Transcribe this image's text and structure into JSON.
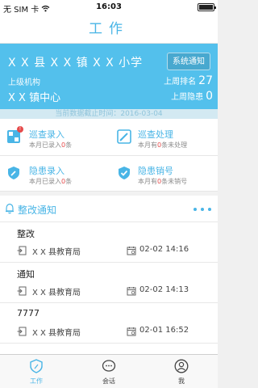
{
  "status_bar": {
    "carrier": "无 SIM 卡",
    "time": "16:03"
  },
  "title_bar": {
    "title": "工作"
  },
  "school": {
    "name": "X X 县 X X 镇 X X 小学",
    "notice_button": "系统通知",
    "parent_label": "上级机构",
    "parent_name": "X X 镇中心",
    "rank_label": "上周排名",
    "rank_value": "27",
    "hazard_label": "上周隐患",
    "hazard_value": "0"
  },
  "data_date": "当前数据截止时间：2016-03-04",
  "actions": [
    {
      "name": "巡查录入",
      "sub_pre": "本月已录入",
      "sub_num": "0",
      "sub_post": "条",
      "icon": "patrol-entry-icon",
      "badge": "!"
    },
    {
      "name": "巡查处理",
      "sub_pre": "本月有",
      "sub_num": "0",
      "sub_post": "条未处理",
      "icon": "patrol-handle-icon"
    },
    {
      "name": "隐患录入",
      "sub_pre": "本月已录入",
      "sub_num": "0",
      "sub_post": "条",
      "icon": "hazard-entry-icon"
    },
    {
      "name": "隐患销号",
      "sub_pre": "本月有",
      "sub_num": "0",
      "sub_post": "条未销号",
      "icon": "hazard-close-icon"
    }
  ],
  "notices": {
    "title": "整改通知",
    "items": [
      {
        "title": "整改",
        "source": "X X 县教育局",
        "time": "02-02 14:16"
      },
      {
        "title": "通知",
        "source": "X X 县教育局",
        "time": "02-02 14:13"
      },
      {
        "title": "7777",
        "source": "X X 县教育局",
        "time": "02-01 16:52"
      }
    ]
  },
  "tabs": [
    {
      "label": "工作",
      "icon": "shield-icon",
      "active": true
    },
    {
      "label": "会话",
      "icon": "chat-icon",
      "active": false
    },
    {
      "label": "我",
      "icon": "user-icon",
      "active": false
    }
  ],
  "colors": {
    "accent": "#49b5e6",
    "card": "#53c0ec",
    "alert": "#e64b4b"
  }
}
